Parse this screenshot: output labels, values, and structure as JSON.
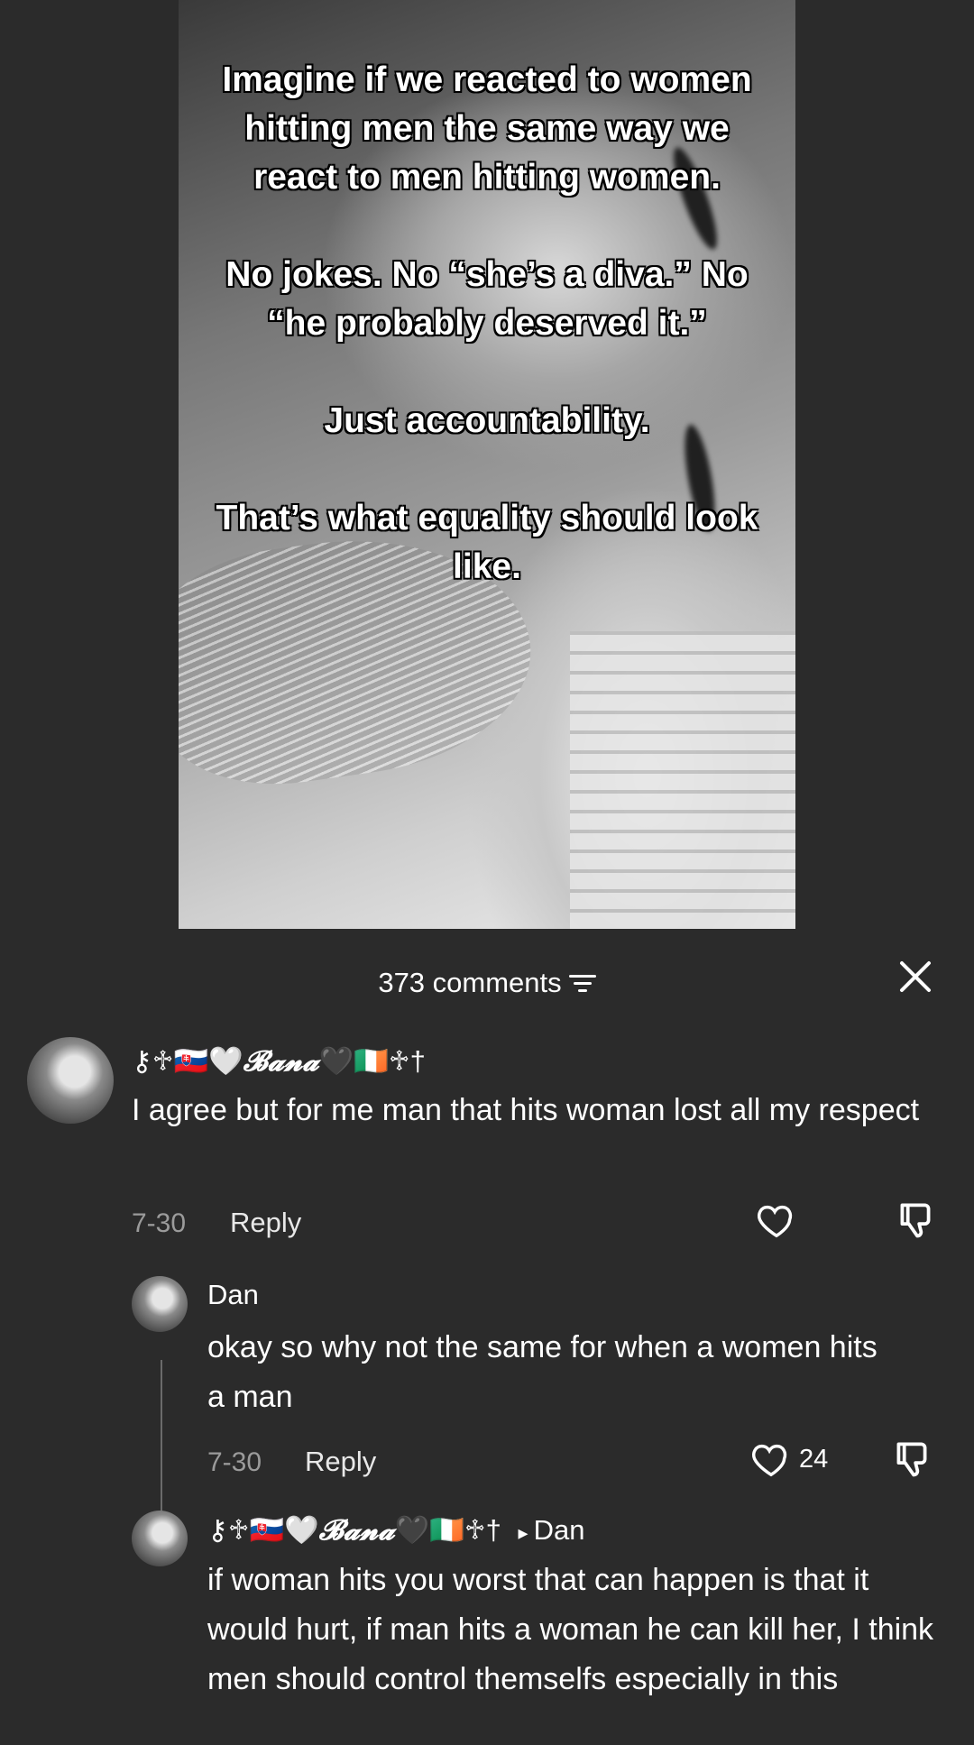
{
  "video": {
    "overlay_lines": [
      "Imagine if we reacted to women hitting men the same way we react to men hitting women.",
      "No jokes. No “she’s a diva.” No “he probably deserved it.”",
      "Just accountability.",
      "That’s what equality should look like."
    ]
  },
  "comments_header": {
    "count_label": "373 comments"
  },
  "comments": [
    {
      "author_prefix": "⚷♱🇸🇰🤍",
      "author_name": "𝓑𝓪𝓷𝓪",
      "author_suffix": "🖤🇮🇪♱†",
      "text": "I agree but for me man that hits woman lost all my respect",
      "date": "7-30",
      "reply_label": "Reply",
      "likes": ""
    },
    {
      "author_name": "Dan",
      "text": "okay so why not the same for when a women hits a man",
      "date": "7-30",
      "reply_label": "Reply",
      "likes": "24"
    },
    {
      "author_prefix": "⚷♱🇸🇰🤍",
      "author_name": "𝓑𝓪𝓷𝓪",
      "author_suffix": "🖤🇮🇪♱†",
      "reply_to_arrow": "▸",
      "reply_to": "Dan",
      "text": "if woman hits you worst that can happen is that it would hurt, if man hits a woman he can kill her, I think men should control themselfs especially in this"
    }
  ],
  "icons": {
    "filter": "filter-lines-icon",
    "close": "close-icon",
    "like": "heart-outline-icon",
    "dislike": "thumbs-down-icon"
  },
  "colors": {
    "background": "#2b2b2b",
    "muted_text": "#9b9b9b"
  }
}
